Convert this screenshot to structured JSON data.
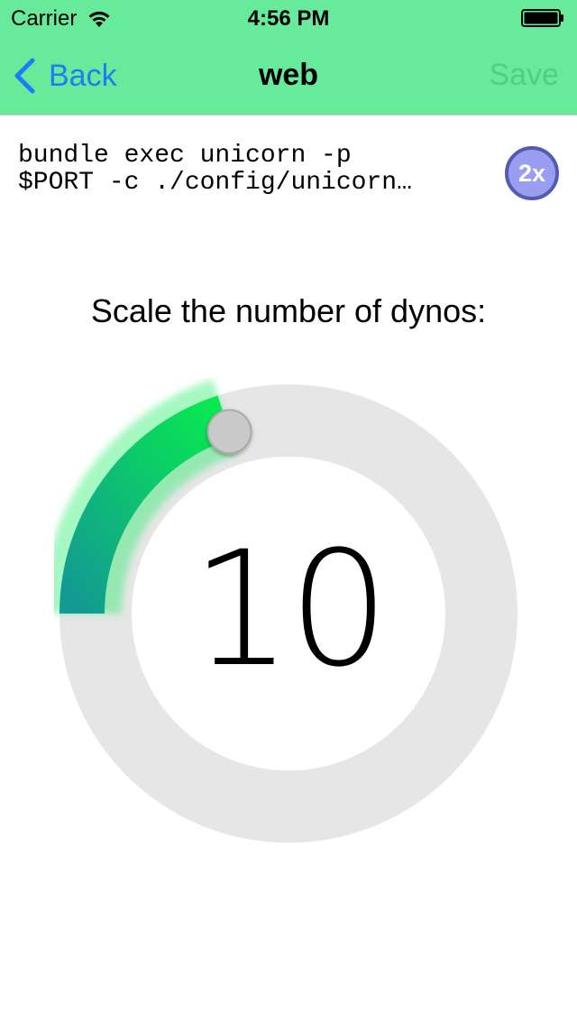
{
  "status_bar": {
    "carrier": "Carrier",
    "time": "4:56 PM",
    "icons": [
      "wifi-icon",
      "battery-icon"
    ]
  },
  "nav": {
    "back_label": "Back",
    "title": "web",
    "save_label": "Save",
    "icons": [
      "chevron-left-icon"
    ]
  },
  "process": {
    "command_line1": "bundle exec unicorn -p",
    "command_line2": "$PORT -c ./config/unicorn…",
    "dyno_size": "2x"
  },
  "scale": {
    "prompt": "Scale the number of dynos:",
    "count": "10",
    "fill_fraction": 0.2
  },
  "colors": {
    "nav_bar": "#67eb9a",
    "back_text": "#1a7ef5",
    "save_disabled": "#4fcf84",
    "badge_fill": "#9a9ef0",
    "badge_border": "#555cab",
    "dial_track": "#e6e6e6",
    "arc_start": "#139a93",
    "arc_end": "#08ea4f"
  }
}
